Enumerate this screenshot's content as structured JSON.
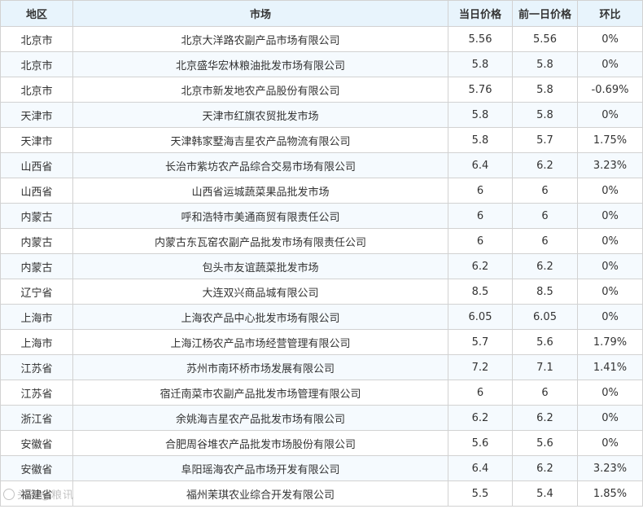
{
  "table": {
    "headers": {
      "region": "地区",
      "market": "市场",
      "today_price": "当日价格",
      "prev_price": "前一日价格",
      "change": "环比"
    },
    "rows": [
      {
        "region": "北京市",
        "market": "北京大洋路农副产品市场有限公司",
        "today": "5.56",
        "prev": "5.56",
        "change": "0%"
      },
      {
        "region": "北京市",
        "market": "北京盛华宏林粮油批发市场有限公司",
        "today": "5.8",
        "prev": "5.8",
        "change": "0%"
      },
      {
        "region": "北京市",
        "market": "北京市新发地农产品股份有限公司",
        "today": "5.76",
        "prev": "5.8",
        "change": "-0.69%"
      },
      {
        "region": "天津市",
        "market": "天津市红旗农贸批发市场",
        "today": "5.8",
        "prev": "5.8",
        "change": "0%"
      },
      {
        "region": "天津市",
        "market": "天津韩家墅海吉星农产品物流有限公司",
        "today": "5.8",
        "prev": "5.7",
        "change": "1.75%"
      },
      {
        "region": "山西省",
        "market": "长治市紫坊农产品综合交易市场有限公司",
        "today": "6.4",
        "prev": "6.2",
        "change": "3.23%"
      },
      {
        "region": "山西省",
        "market": "山西省运城蔬菜果品批发市场",
        "today": "6",
        "prev": "6",
        "change": "0%"
      },
      {
        "region": "内蒙古",
        "market": "呼和浩特市美通商贸有限责任公司",
        "today": "6",
        "prev": "6",
        "change": "0%"
      },
      {
        "region": "内蒙古",
        "market": "内蒙古东瓦窑农副产品批发市场有限责任公司",
        "today": "6",
        "prev": "6",
        "change": "0%"
      },
      {
        "region": "内蒙古",
        "market": "包头市友谊蔬菜批发市场",
        "today": "6.2",
        "prev": "6.2",
        "change": "0%"
      },
      {
        "region": "辽宁省",
        "market": "大连双兴商品城有限公司",
        "today": "8.5",
        "prev": "8.5",
        "change": "0%"
      },
      {
        "region": "上海市",
        "market": "上海农产品中心批发市场有限公司",
        "today": "6.05",
        "prev": "6.05",
        "change": "0%"
      },
      {
        "region": "上海市",
        "market": "上海江杨农产品市场经营管理有限公司",
        "today": "5.7",
        "prev": "5.6",
        "change": "1.79%"
      },
      {
        "region": "江苏省",
        "market": "苏州市南环桥市场发展有限公司",
        "today": "7.2",
        "prev": "7.1",
        "change": "1.41%"
      },
      {
        "region": "江苏省",
        "market": "宿迁南菜市农副产品批发市场管理有限公司",
        "today": "6",
        "prev": "6",
        "change": "0%"
      },
      {
        "region": "浙江省",
        "market": "余姚海吉星农产品批发市场有限公司",
        "today": "6.2",
        "prev": "6.2",
        "change": "0%"
      },
      {
        "region": "安徽省",
        "market": "合肥周谷堆农产品批发市场股份有限公司",
        "today": "5.6",
        "prev": "5.6",
        "change": "0%"
      },
      {
        "region": "安徽省",
        "market": "阜阳瑶海农产品市场开发有限公司",
        "today": "6.4",
        "prev": "6.2",
        "change": "3.23%"
      },
      {
        "region": "福建省",
        "market": "福州茉琪农业综合开发有限公司",
        "today": "5.5",
        "prev": "5.4",
        "change": "1.85%"
      }
    ]
  },
  "watermark": {
    "text": "头条@粮讯",
    "icon": "watermark-logo-icon"
  }
}
